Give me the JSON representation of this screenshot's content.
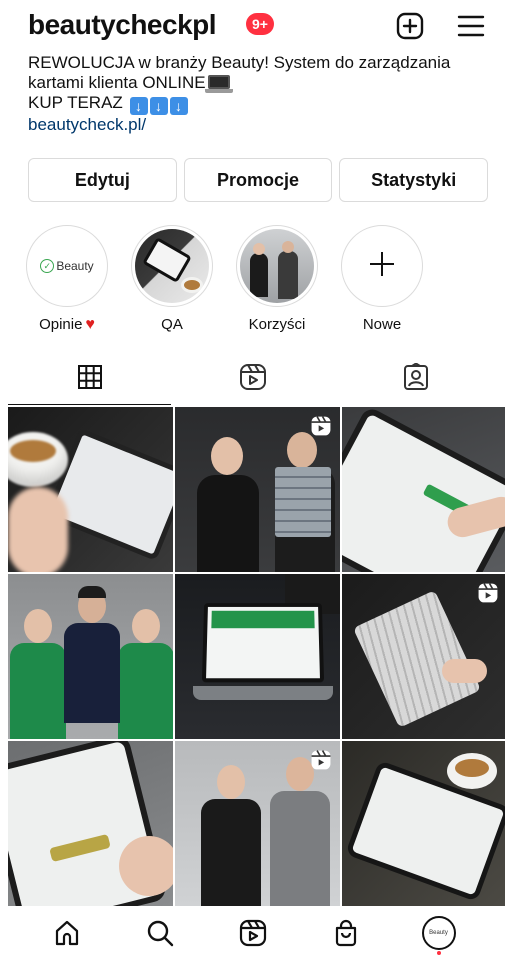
{
  "header": {
    "username": "beautycheckpl",
    "notification_badge": "9+",
    "add_icon": "plus-square-icon",
    "menu_icon": "hamburger-menu-icon"
  },
  "bio": {
    "line1": "REWOLUCJA w branży Beauty! System do zarządzania",
    "line2": "kartami klienta ONLINE",
    "line3": "KUP TERAZ",
    "link": "beautycheck.pl/"
  },
  "buttons": {
    "edit": "Edytuj",
    "promotions": "Promocje",
    "stats": "Statystyki"
  },
  "highlights": [
    {
      "label": "Opinie",
      "cover_text": "Beauty",
      "icon": "heart-icon"
    },
    {
      "label": "QA"
    },
    {
      "label": "Korzyści"
    },
    {
      "label": "Nowe",
      "icon": "plus-icon"
    }
  ],
  "tabs": [
    {
      "name": "posts",
      "icon": "grid-icon",
      "active": true
    },
    {
      "name": "reels",
      "icon": "reels-icon",
      "active": false
    },
    {
      "name": "tagged",
      "icon": "tagged-person-icon",
      "active": false
    }
  ],
  "posts": [
    {
      "kind": "photo",
      "reel": false
    },
    {
      "kind": "photo",
      "reel": true
    },
    {
      "kind": "photo",
      "reel": false
    },
    {
      "kind": "photo",
      "reel": false
    },
    {
      "kind": "photo",
      "reel": false
    },
    {
      "kind": "photo",
      "reel": true
    },
    {
      "kind": "photo",
      "reel": false
    },
    {
      "kind": "photo",
      "reel": true
    },
    {
      "kind": "photo",
      "reel": false
    }
  ],
  "bottom_nav": {
    "items": [
      "home-icon",
      "search-icon",
      "reels-icon",
      "shop-icon",
      "profile-avatar"
    ],
    "avatar_text": "Beauty"
  },
  "colors": {
    "badge": "#ff3040",
    "link": "#00376b",
    "brand_green": "#2f9e4d"
  }
}
